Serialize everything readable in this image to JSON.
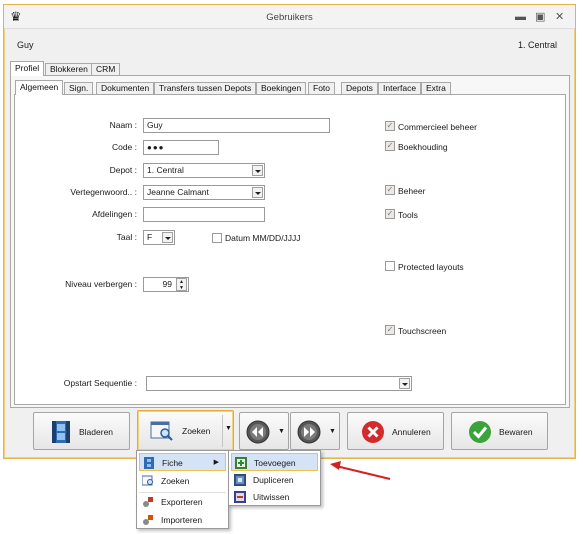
{
  "window": {
    "title": "Gebruikers",
    "minimize_icon": "minimize-icon",
    "maximize_icon": "maximize-icon",
    "close_icon": "close-icon"
  },
  "header": {
    "user_name": "Guy",
    "depot_name": "1. Central"
  },
  "outer_tabs": [
    "Profiel",
    "Blokkeren",
    "CRM"
  ],
  "inner_tabs": [
    "Algemeen",
    "Sign.",
    "Dokumenten",
    "Transfers tussen Depots",
    "Boekingen",
    "Foto",
    "Depots",
    "Interface",
    "Extra"
  ],
  "form": {
    "naam_label": "Naam :",
    "naam_value": "Guy",
    "code_label": "Code :",
    "code_value": "●●●",
    "depot_label": "Depot :",
    "depot_value": "1. Central",
    "vertegen_label": "Vertegenwoord.. :",
    "vertegen_value": "Jeanne Calmant",
    "afdelingen_label": "Afdelingen :",
    "afdelingen_value": "",
    "taal_label": "Taal :",
    "taal_value": "F",
    "datum_label": "Datum MM/DD/JJJJ",
    "datum_checked": false,
    "niveau_label": "Niveau verbergen :",
    "niveau_value": "99",
    "opstart_label": "Opstart Sequentie :",
    "opstart_value": ""
  },
  "checkboxes": [
    {
      "label": "Commercieel beheer",
      "checked": true
    },
    {
      "label": "Boekhouding",
      "checked": true
    },
    {
      "label": "Beheer",
      "checked": true
    },
    {
      "label": "Tools",
      "checked": true
    },
    {
      "label": "Protected layouts",
      "checked": false
    },
    {
      "label": "Touchscreen",
      "checked": true
    }
  ],
  "toolbar": {
    "bladeren": "Bladeren",
    "zoeken": "Zoeken",
    "annuleren": "Annuleren",
    "bewaren": "Bewaren"
  },
  "menu": {
    "items": [
      "Fiche",
      "Zoeken",
      "Exporteren",
      "Importeren"
    ],
    "submenu": [
      "Toevoegen",
      "Dupliceren",
      "Uitwissen"
    ]
  },
  "colors": {
    "accent_border": "#e4b44a",
    "menu_highlight": "#d5e3f7",
    "arrow": "#d42020",
    "cancel_red": "#d32b2b",
    "save_green": "#3aa33a"
  }
}
